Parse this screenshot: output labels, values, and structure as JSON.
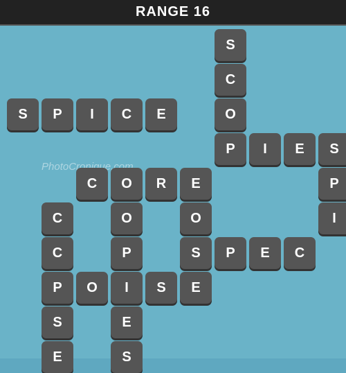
{
  "header": {
    "title": "RANGE 16"
  },
  "watermark": "PhotoCronique.com",
  "tiles": [
    {
      "letter": "S",
      "col": 7,
      "row": 1
    },
    {
      "letter": "C",
      "col": 7,
      "row": 2
    },
    {
      "letter": "O",
      "col": 7,
      "row": 3
    },
    {
      "letter": "S",
      "col": 1,
      "row": 3
    },
    {
      "letter": "P",
      "col": 2,
      "row": 3
    },
    {
      "letter": "I",
      "col": 3,
      "row": 3
    },
    {
      "letter": "C",
      "col": 4,
      "row": 3
    },
    {
      "letter": "E",
      "col": 5,
      "row": 3
    },
    {
      "letter": "P",
      "col": 7,
      "row": 4
    },
    {
      "letter": "I",
      "col": 8,
      "row": 4
    },
    {
      "letter": "E",
      "col": 9,
      "row": 4
    },
    {
      "letter": "S",
      "col": 10,
      "row": 4
    },
    {
      "letter": "C",
      "col": 3,
      "row": 5
    },
    {
      "letter": "O",
      "col": 4,
      "row": 5
    },
    {
      "letter": "R",
      "col": 5,
      "row": 5
    },
    {
      "letter": "E",
      "col": 6,
      "row": 5
    },
    {
      "letter": "P",
      "col": 10,
      "row": 5
    },
    {
      "letter": "C",
      "col": 2,
      "row": 6
    },
    {
      "letter": "O",
      "col": 4,
      "row": 6
    },
    {
      "letter": "O",
      "col": 6,
      "row": 6
    },
    {
      "letter": "I",
      "col": 10,
      "row": 6
    },
    {
      "letter": "C",
      "col": 2,
      "row": 7
    },
    {
      "letter": "P",
      "col": 4,
      "row": 7
    },
    {
      "letter": "S",
      "col": 6,
      "row": 7
    },
    {
      "letter": "P",
      "col": 7,
      "row": 7
    },
    {
      "letter": "E",
      "col": 8,
      "row": 7
    },
    {
      "letter": "C",
      "col": 9,
      "row": 7
    },
    {
      "letter": "P",
      "col": 2,
      "row": 8
    },
    {
      "letter": "O",
      "col": 3,
      "row": 8
    },
    {
      "letter": "I",
      "col": 4,
      "row": 8
    },
    {
      "letter": "S",
      "col": 5,
      "row": 8
    },
    {
      "letter": "E",
      "col": 6,
      "row": 8
    },
    {
      "letter": "S",
      "col": 2,
      "row": 9
    },
    {
      "letter": "E",
      "col": 4,
      "row": 9
    },
    {
      "letter": "E",
      "col": 2,
      "row": 10
    },
    {
      "letter": "S",
      "col": 4,
      "row": 10
    }
  ]
}
